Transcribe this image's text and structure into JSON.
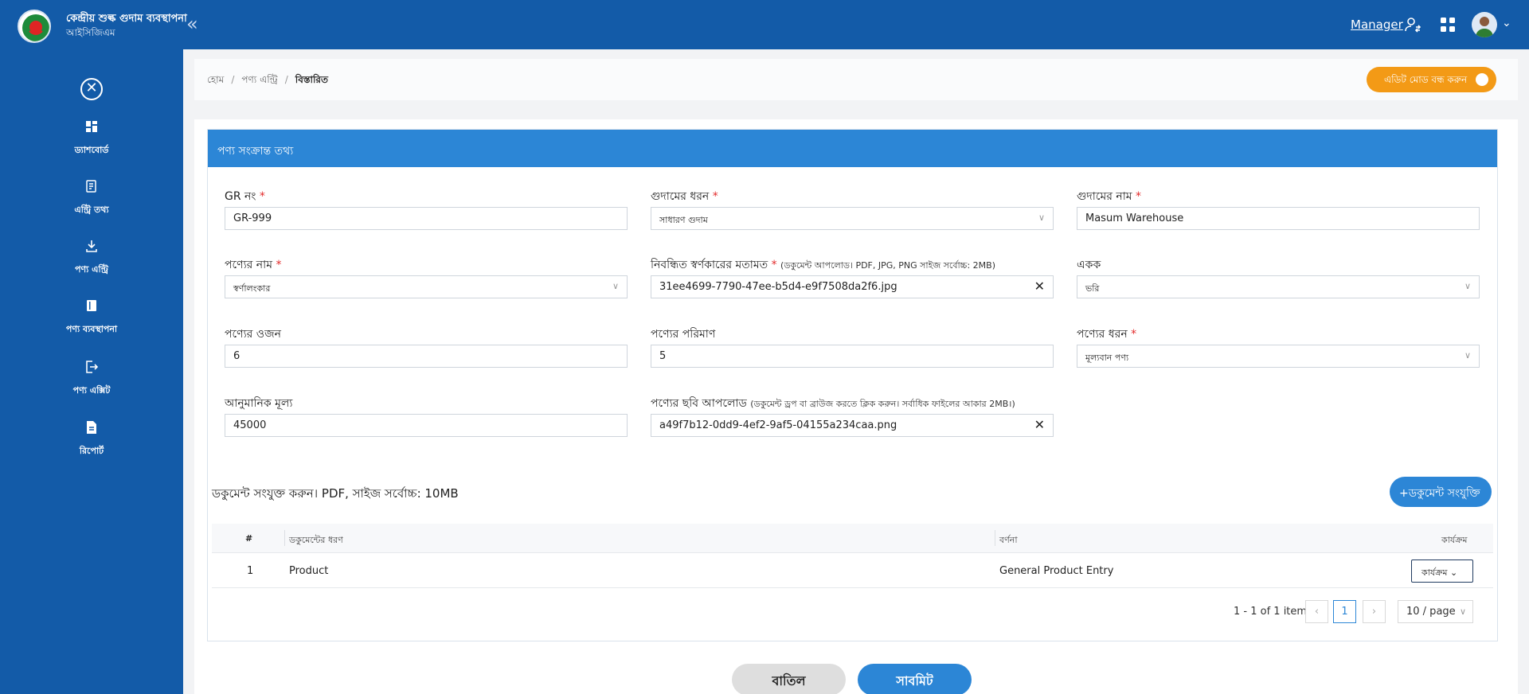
{
  "header": {
    "title": "কেন্দ্রীয় শুল্ক গুদাম ব্যবস্থাপনা",
    "subtitle": "আইসিজিএম",
    "role": "Manager"
  },
  "sidebar": {
    "items": [
      {
        "label": "ড্যাশবোর্ড",
        "icon": "dashboard-icon"
      },
      {
        "label": "এন্ট্রি তথ্য",
        "icon": "entry-info-icon"
      },
      {
        "label": "পণ্য এন্ট্রি",
        "icon": "download-icon"
      },
      {
        "label": "পণ্য ব্যবস্থাপনা",
        "icon": "book-icon"
      },
      {
        "label": "পণ্য এক্সিট",
        "icon": "exit-icon"
      },
      {
        "label": "রিপোর্ট",
        "icon": "report-icon"
      }
    ]
  },
  "breadcrumb": {
    "home": "হোম",
    "section": "পণ্য এন্ট্রি",
    "current": "বিস্তারিত",
    "separator": "/"
  },
  "edit_toggle": {
    "label": "এডিট মোড বন্ধ করুন"
  },
  "panel": {
    "title": "পণ্য সংক্রান্ত তথ্য",
    "required_mark": "*",
    "fields": {
      "gr_no": {
        "label": "GR নং",
        "value": "GR-999"
      },
      "warehouse_type": {
        "label": "গুদামের ধরন",
        "value": "সাধারণ গুদাম"
      },
      "warehouse_name": {
        "label": "গুদামের নাম",
        "value": "Masum Warehouse"
      },
      "product_name": {
        "label": "পণ্যের নাম",
        "value": "স্বর্ণালংকার"
      },
      "goldsmith_opinion": {
        "label": "নিবন্ধিত স্বর্ণকারের মতামত",
        "hint": "(ডকুমেন্ট আপলোড। PDF, JPG, PNG সাইজ সর্বোচ্চ: 2MB)",
        "value": "31ee4699-7790-47ee-b5d4-e9f7508da2f6.jpg"
      },
      "unit": {
        "label": "একক",
        "value": "ভরি"
      },
      "weight": {
        "label": "পণ্যের ওজন",
        "value": "6"
      },
      "quantity": {
        "label": "পণ্যের পরিমাণ",
        "value": "5"
      },
      "product_type": {
        "label": "পণ্যের ধরন",
        "value": "মূল্যবান পণ্য"
      },
      "estimated_value": {
        "label": "আনুমানিক মূল্য",
        "value": "45000"
      },
      "image_upload": {
        "label": "পণ্যের ছবি আপলোড",
        "hint": "(ডকুমেন্ট ড্রপ বা ব্রাউজ করতে ক্লিক করুন। সর্বাধিক ফাইলের আকার 2MB।)",
        "value": "a49f7b12-0dd9-4ef2-9af5-04155a234caa.png"
      }
    }
  },
  "documents": {
    "note": "ডকুমেন্ট সংযুক্ত করুন। PDF, সাইজ সর্বোচ্চ: 10MB",
    "add_button": "ডকুমেন্ট সংযুক্তি",
    "columns": [
      "#",
      "ডকুমেন্টের ধরণ",
      "বর্ণনা",
      "কার্যক্রম"
    ],
    "rows": [
      {
        "index": "1",
        "type": "Product",
        "description": "General Product Entry",
        "action": "কার্যক্রম"
      }
    ],
    "pagination": {
      "info": "1 - 1 of 1 items",
      "page": "1",
      "page_size": "10 / page"
    }
  },
  "footer": {
    "cancel": "বাতিল",
    "submit": "সাবমিট"
  },
  "colors": {
    "primary": "#135ba8",
    "accent": "#2c86d6",
    "warning": "#f39a16",
    "required": "#e32b2b"
  }
}
